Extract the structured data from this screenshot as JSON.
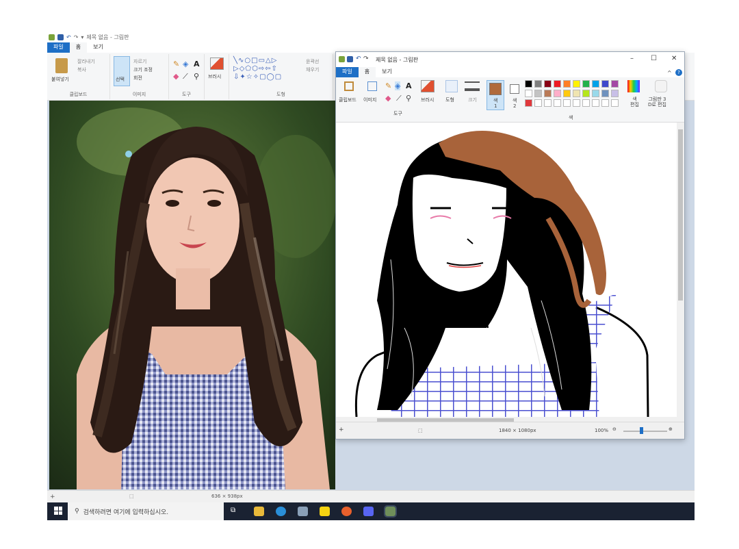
{
  "back_window": {
    "title": "제목 없음 - 그림판",
    "tabs": [
      "파일",
      "홈",
      "보기"
    ],
    "ribbon": {
      "clipboard": {
        "paste": "붙여넣기",
        "cut": "잘라내기",
        "copy": "복사",
        "label": "클립보드"
      },
      "image": {
        "select": "선택",
        "crop": "자르기",
        "resize": "크기 조정",
        "rotate": "회전",
        "label": "이미지"
      },
      "tools": {
        "label": "도구"
      },
      "brush": {
        "label": "브러시"
      },
      "shapes": {
        "outline": "윤곽선",
        "fill": "채우기",
        "label": "도형"
      }
    },
    "status": {
      "size": "636 × 938px"
    }
  },
  "front_window": {
    "title": "제목 없음 - 그림판",
    "tabs": [
      "파일",
      "홈",
      "보기"
    ],
    "ribbon": {
      "clipboard": "클립보드",
      "image": "이미지",
      "tools_label": "도구",
      "brush": "브러시",
      "shapes": "도형",
      "size": "크기",
      "color1": "색\n1",
      "color2": "색\n2",
      "edit_colors": "색\n편집",
      "paint3d": "그림판 3\nD로 편집",
      "colors_label": "색"
    },
    "colors": {
      "color1": "#b06a3c",
      "color2": "#ffffff",
      "palette": [
        "#000000",
        "#7f7f7f",
        "#880015",
        "#ed1c24",
        "#ff7f27",
        "#fff200",
        "#22b14c",
        "#00a2e8",
        "#3f48cc",
        "#a349a4",
        "#ffffff",
        "#c3c3c3",
        "#b97a57",
        "#ffaec9",
        "#ffc90e",
        "#efe4b0",
        "#b5e61d",
        "#99d9ea",
        "#7092be",
        "#c8bfe7",
        "#e0383c",
        "#ffffff",
        "#ffffff",
        "#ffffff",
        "#ffffff",
        "#ffffff",
        "#ffffff",
        "#ffffff",
        "#ffffff",
        "#ffffff"
      ]
    },
    "status": {
      "size": "1840 × 1080px",
      "zoom": "100%"
    }
  },
  "taskbar": {
    "search_placeholder": "검색하려면 여기에 입력하십시오."
  }
}
